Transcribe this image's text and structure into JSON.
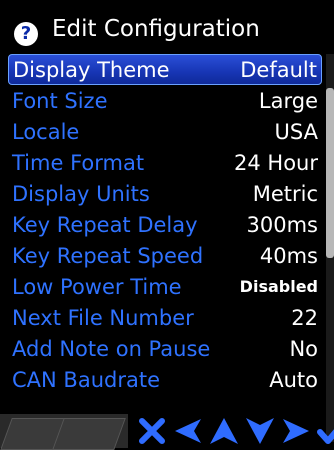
{
  "header": {
    "title": "Edit Configuration",
    "help_icon": "question-icon"
  },
  "rows": [
    {
      "label": "Display Theme",
      "value": "Default",
      "selected": true
    },
    {
      "label": "Font Size",
      "value": "Large"
    },
    {
      "label": "Locale",
      "value": "USA"
    },
    {
      "label": "Time Format",
      "value": "24 Hour"
    },
    {
      "label": "Display Units",
      "value": "Metric"
    },
    {
      "label": "Key Repeat Delay",
      "value": "300ms"
    },
    {
      "label": "Key Repeat Speed",
      "value": "40ms"
    },
    {
      "label": "Low Power Time",
      "value": "Disabled"
    },
    {
      "label": "Next File Number",
      "value": "22"
    },
    {
      "label": "Add Note on Pause",
      "value": "No"
    },
    {
      "label": "CAN Baudrate",
      "value": "Auto"
    }
  ],
  "nav": {
    "icons": [
      "close-icon",
      "left-arrow-icon",
      "up-arrow-icon",
      "down-arrow-icon",
      "right-arrow-icon",
      "check-icon"
    ],
    "color": "#2f6cff"
  },
  "colors": {
    "label": "#2f72ff",
    "selected_bg": "#1f3fc4",
    "value": "#ffffff"
  }
}
